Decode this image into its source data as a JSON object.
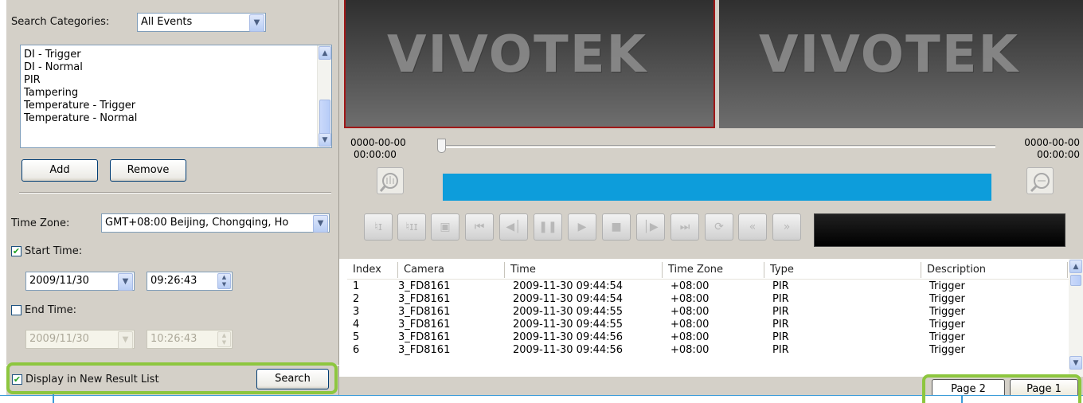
{
  "search": {
    "categories_label": "Search Categories:",
    "categories_value": "All Events",
    "event_list": [
      "DI - Trigger",
      "DI - Normal",
      "PIR",
      "Tampering",
      "Temperature - Trigger",
      "Temperature - Normal"
    ],
    "add_label": "Add",
    "remove_label": "Remove",
    "timezone_label": "Time Zone:",
    "timezone_value": "GMT+08:00 Beijing, Chongqing, Ho",
    "start_time_label": "Start Time:",
    "start_date": "2009/11/30",
    "start_time": "09:26:43",
    "end_time_label": "End Time:",
    "end_date": "2009/11/30",
    "end_time": "10:26:43",
    "display_new_list_label": "Display in New Result List",
    "search_button": "Search"
  },
  "video": {
    "logo_text": "VIVOTEK"
  },
  "timeline": {
    "start_date": "0000-00-00",
    "start_time": "00:00:00",
    "end_date": "0000-00-00",
    "end_time": "00:00:00"
  },
  "results": {
    "headers": [
      "Index",
      "Camera",
      "Time",
      "Time Zone",
      "Type",
      "Description"
    ],
    "rows": [
      {
        "index": "1",
        "camera": "3_FD8161",
        "time": "2009-11-30 09:44:54",
        "zone": "+08:00",
        "type": "PIR",
        "desc": "Trigger"
      },
      {
        "index": "2",
        "camera": "3_FD8161",
        "time": "2009-11-30 09:44:54",
        "zone": "+08:00",
        "type": "PIR",
        "desc": "Trigger"
      },
      {
        "index": "3",
        "camera": "3_FD8161",
        "time": "2009-11-30 09:44:55",
        "zone": "+08:00",
        "type": "PIR",
        "desc": "Trigger"
      },
      {
        "index": "4",
        "camera": "3_FD8161",
        "time": "2009-11-30 09:44:55",
        "zone": "+08:00",
        "type": "PIR",
        "desc": "Trigger"
      },
      {
        "index": "5",
        "camera": "3_FD8161",
        "time": "2009-11-30 09:44:56",
        "zone": "+08:00",
        "type": "PIR",
        "desc": "Trigger"
      },
      {
        "index": "6",
        "camera": "3_FD8161",
        "time": "2009-11-30 09:44:56",
        "zone": "+08:00",
        "type": "PIR",
        "desc": "Trigger"
      }
    ]
  },
  "pages": [
    "Page 2",
    "Page 1"
  ],
  "colors": {
    "highlight": "#8dc63f",
    "progress": "#0d9ddb",
    "panel": "#d4d0c8"
  }
}
